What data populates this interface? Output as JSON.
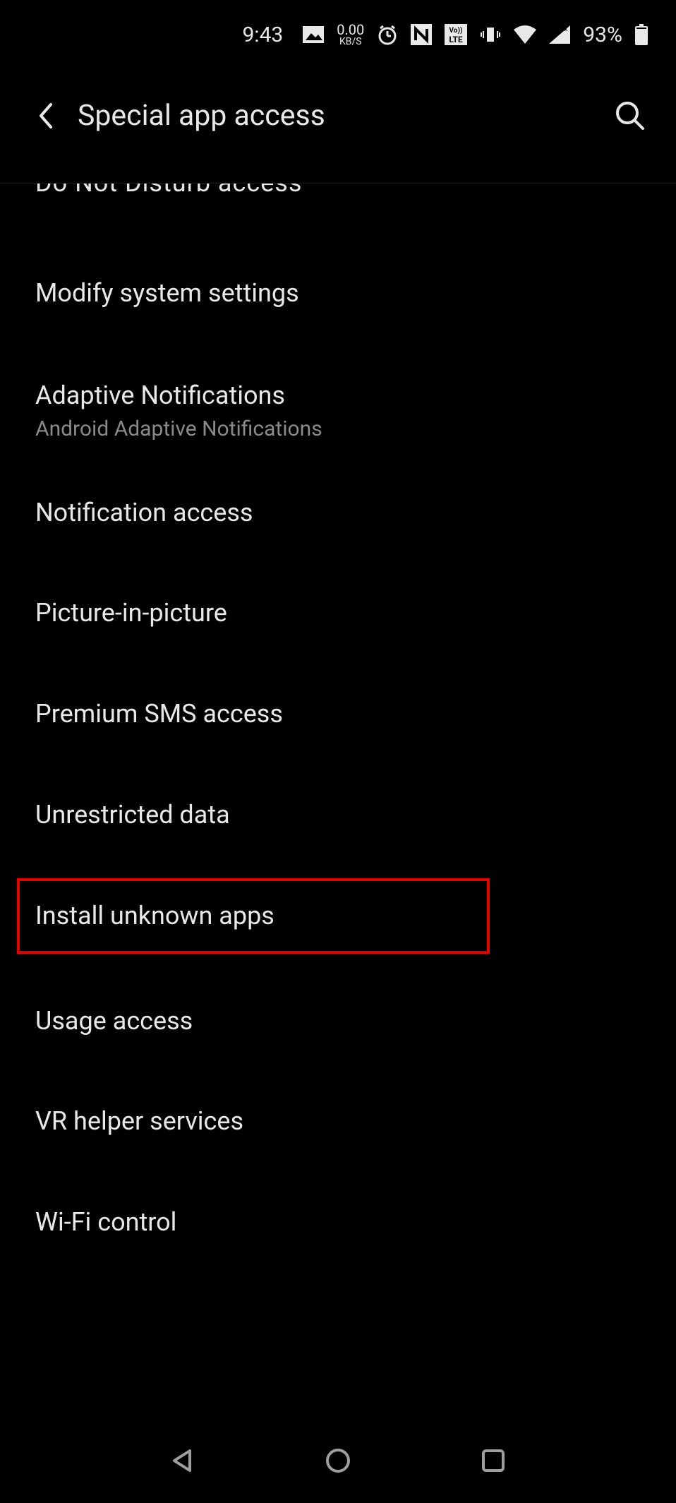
{
  "status": {
    "time": "9:43",
    "kbs_top": "0.00",
    "kbs_bottom": "KB/S",
    "nfc": "N",
    "volte": "Vo›LTE",
    "battery_pct": "93%"
  },
  "appbar": {
    "title": "Special app access"
  },
  "list": {
    "cutoff": "Do Not Disturb access",
    "items": [
      {
        "title": "Modify system settings",
        "sub": ""
      },
      {
        "title": "Adaptive Notifications",
        "sub": "Android Adaptive Notifications"
      },
      {
        "title": "Notification access",
        "sub": ""
      },
      {
        "title": "Picture-in-picture",
        "sub": ""
      },
      {
        "title": "Premium SMS access",
        "sub": ""
      },
      {
        "title": "Unrestricted data",
        "sub": ""
      },
      {
        "title": "Install unknown apps",
        "sub": ""
      },
      {
        "title": "Usage access",
        "sub": ""
      },
      {
        "title": "VR helper services",
        "sub": ""
      },
      {
        "title": "Wi-Fi control",
        "sub": ""
      }
    ]
  }
}
